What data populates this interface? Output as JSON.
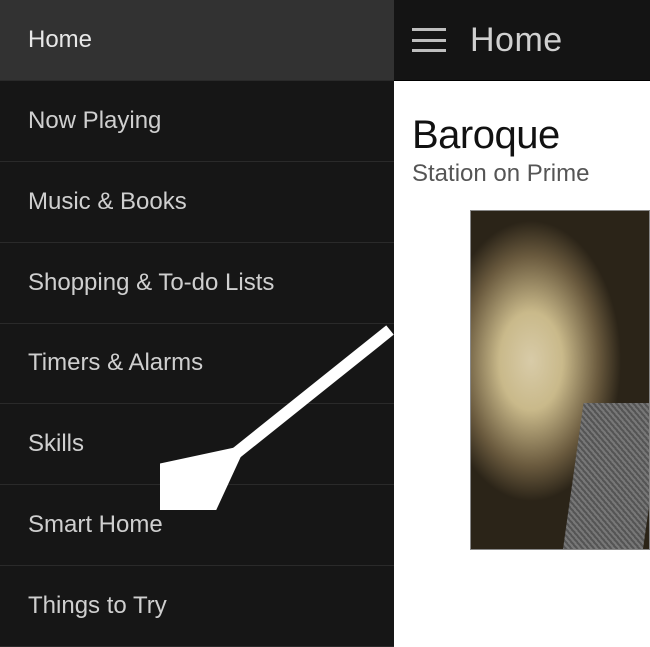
{
  "drawer": {
    "items": [
      {
        "label": "Home",
        "active": true
      },
      {
        "label": "Now Playing",
        "active": false
      },
      {
        "label": "Music & Books",
        "active": false
      },
      {
        "label": "Shopping & To-do Lists",
        "active": false
      },
      {
        "label": "Timers & Alarms",
        "active": false
      },
      {
        "label": "Skills",
        "active": false
      },
      {
        "label": "Smart Home",
        "active": false
      },
      {
        "label": "Things to Try",
        "active": false
      }
    ]
  },
  "header": {
    "title": "Home"
  },
  "card": {
    "title": "Baroque",
    "subtitle": "Station on Prime"
  }
}
